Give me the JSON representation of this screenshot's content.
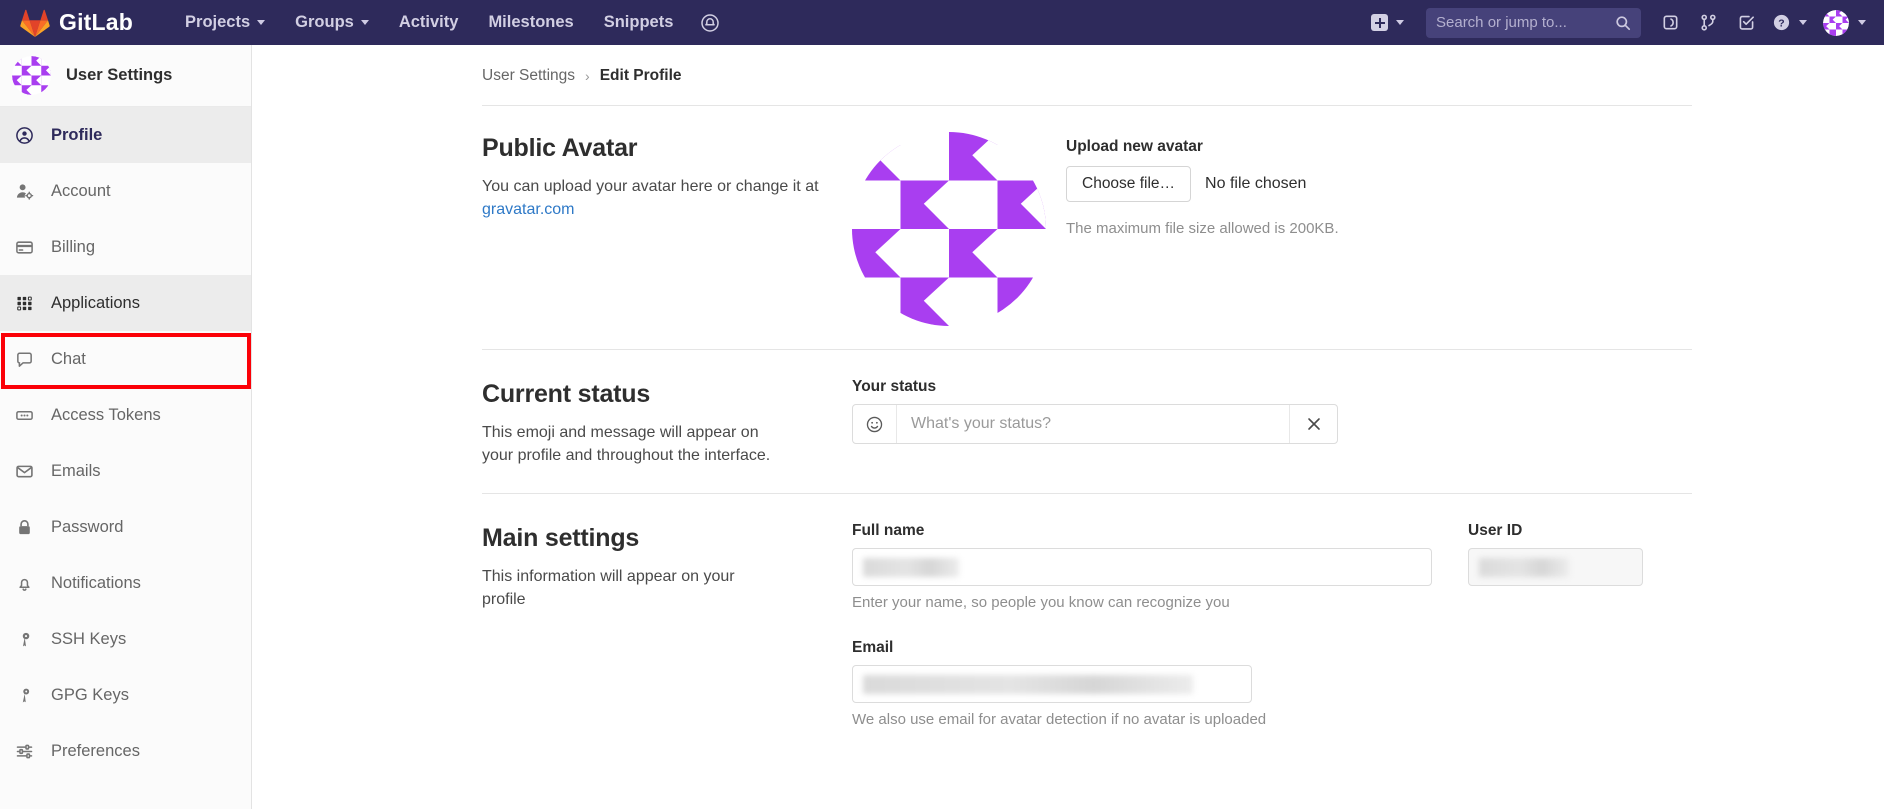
{
  "nav": {
    "brand": "GitLab",
    "links": [
      {
        "label": "Projects",
        "caret": true,
        "name": "nav-projects"
      },
      {
        "label": "Groups",
        "caret": true,
        "name": "nav-groups"
      },
      {
        "label": "Activity",
        "caret": false,
        "name": "nav-activity"
      },
      {
        "label": "Milestones",
        "caret": false,
        "name": "nav-milestones"
      },
      {
        "label": "Snippets",
        "caret": false,
        "name": "nav-snippets"
      }
    ],
    "bell_icon": "bell-announcement-icon",
    "plus_icon": "plus-square-icon",
    "search_placeholder": "Search or jump to...",
    "search_icon": "search-icon",
    "issues_icon": "issues-icon",
    "merge_requests_icon": "merge-request-icon",
    "todos_icon": "todo-checklist-icon",
    "help_icon": "help-question-icon",
    "avatar_icon": "user-avatar",
    "accent": "#2e2a5b"
  },
  "sidebar": {
    "title": "User Settings",
    "avatar_icon": "user-avatar",
    "items": [
      {
        "label": "Profile",
        "icon": "profile-user-circle-icon",
        "state": "active"
      },
      {
        "label": "Account",
        "icon": "account-user-gear-icon",
        "state": "normal"
      },
      {
        "label": "Billing",
        "icon": "billing-credit-card-icon",
        "state": "normal"
      },
      {
        "label": "Applications",
        "icon": "applications-grid-icon",
        "state": "hovered"
      },
      {
        "label": "Chat",
        "icon": "chat-bubble-icon",
        "state": "normal"
      },
      {
        "label": "Access Tokens",
        "icon": "access-token-icon",
        "state": "normal"
      },
      {
        "label": "Emails",
        "icon": "email-envelope-icon",
        "state": "normal"
      },
      {
        "label": "Password",
        "icon": "password-lock-icon",
        "state": "normal"
      },
      {
        "label": "Notifications",
        "icon": "notifications-bell-icon",
        "state": "normal"
      },
      {
        "label": "SSH Keys",
        "icon": "ssh-key-icon",
        "state": "normal"
      },
      {
        "label": "GPG Keys",
        "icon": "gpg-key-icon",
        "state": "normal"
      },
      {
        "label": "Preferences",
        "icon": "preferences-sliders-icon",
        "state": "normal"
      }
    ],
    "highlight_color": "#fb0007",
    "highlighted_item": "Applications",
    "scrollbar": {
      "up_arrow_icon": "scroll-up-arrow-icon"
    }
  },
  "breadcrumb": {
    "parent": "User Settings",
    "separator": "›",
    "current": "Edit Profile"
  },
  "avatar_section": {
    "title": "Public Avatar",
    "desc_prefix": "You can upload your avatar here or change it at",
    "link": "gravatar.com",
    "upload_label": "Upload new avatar",
    "choose_file_button": "Choose file…",
    "no_file_text": "No file chosen",
    "max_size_text": "The maximum file size allowed is 200KB."
  },
  "status_section": {
    "title": "Current status",
    "desc": "This emoji and message will appear on your profile and throughout the interface.",
    "field_label": "Your status",
    "emoji_icon": "smiley-face-icon",
    "placeholder": "What's your status?",
    "clear_icon": "clear-x-icon",
    "value": ""
  },
  "main_settings": {
    "title": "Main settings",
    "desc": "This information will appear on your profile",
    "full_name_label": "Full name",
    "full_name_value": "",
    "full_name_help": "Enter your name, so people you know can recognize you",
    "user_id_label": "User ID",
    "user_id_value": "",
    "email_label": "Email",
    "email_value": "",
    "email_help": "We also use email for avatar detection if no avatar is uploaded"
  }
}
